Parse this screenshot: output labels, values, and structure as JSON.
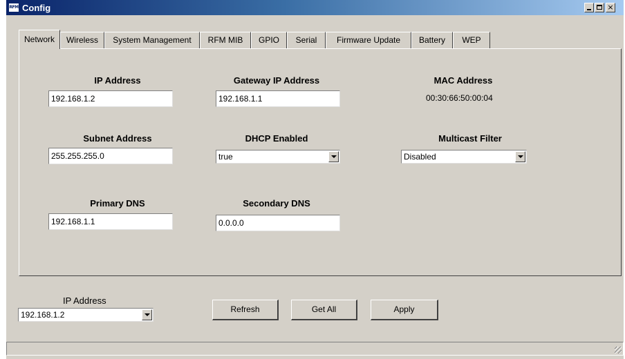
{
  "window": {
    "title": "Config",
    "icon_label": "RFM",
    "caption_buttons": {
      "minimize": "minimize-icon",
      "maximize": "maximize-icon",
      "close": "×"
    }
  },
  "tabs": [
    {
      "label": "Network",
      "active": true
    },
    {
      "label": "Wireless",
      "active": false
    },
    {
      "label": "System Management",
      "active": false
    },
    {
      "label": "RFM MIB",
      "active": false
    },
    {
      "label": "GPIO",
      "active": false
    },
    {
      "label": "Serial",
      "active": false
    },
    {
      "label": "Firmware Update",
      "active": false
    },
    {
      "label": "Battery",
      "active": false
    },
    {
      "label": "WEP",
      "active": false
    }
  ],
  "network": {
    "ip_address": {
      "label": "IP Address",
      "value": "192.168.1.2"
    },
    "gateway_ip": {
      "label": "Gateway IP Address",
      "value": "192.168.1.1"
    },
    "mac_address": {
      "label": "MAC Address",
      "value": "00:30:66:50:00:04"
    },
    "subnet": {
      "label": "Subnet Address",
      "value": "255.255.255.0"
    },
    "dhcp": {
      "label": "DHCP Enabled",
      "value": "true"
    },
    "multicast": {
      "label": "Multicast Filter",
      "value": "Disabled"
    },
    "primary_dns": {
      "label": "Primary DNS",
      "value": "192.168.1.1"
    },
    "secondary_dns": {
      "label": "Secondary DNS",
      "value": "0.0.0.0"
    }
  },
  "bottom": {
    "ip_select_label": "IP Address",
    "ip_select_value": "192.168.1.2",
    "refresh_label": "Refresh",
    "get_all_label": "Get All",
    "apply_label": "Apply"
  }
}
